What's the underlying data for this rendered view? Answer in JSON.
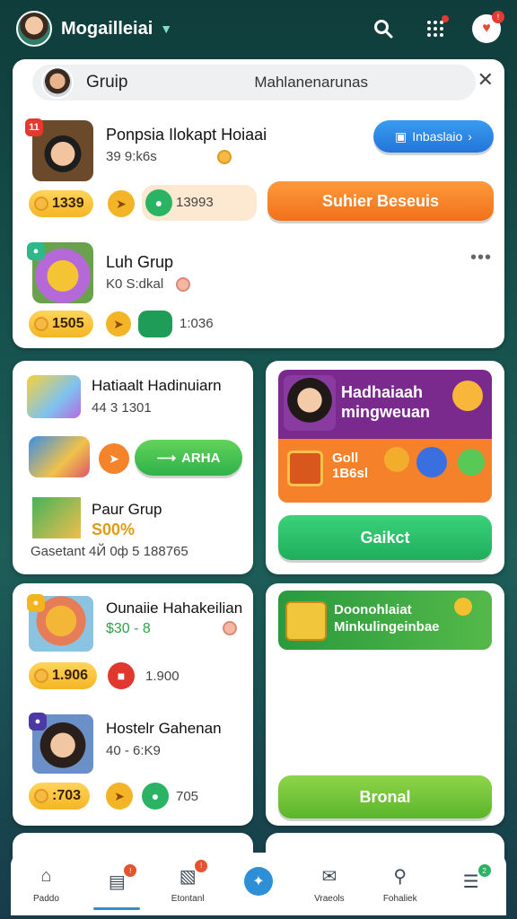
{
  "header": {
    "title": "Mogailleiai",
    "avatar_icon": "user-avatar",
    "actions": [
      "search-icon",
      "grid-icon",
      "notification-icon"
    ],
    "notification_badge": "!"
  },
  "search": {
    "left_text": "Gruip",
    "right_text": "Mahlanenarunas"
  },
  "groups": [
    {
      "badge": "11",
      "name": "Ponpsia Ilokapt Hoiaai",
      "sub": "39 9:k6s",
      "coins": "1339",
      "chip_value": "13993",
      "action_pill": "Inbaslaio",
      "main_button": "Suhier Beseuis"
    },
    {
      "badge": "",
      "name": "Luh Grup",
      "sub": "K0 S:dkal",
      "coins": "1505",
      "chip_value": "1:036"
    }
  ],
  "left_card_1": {
    "title": "Hatiaalt Hadinuiarn",
    "sub": "44 3 1301",
    "action_label": "ARHA",
    "second_title": "Paur Grup",
    "second_value": "S00%",
    "footer": "Gasetant 4Й 0ф 5 188765"
  },
  "right_card_1": {
    "banner_title": "Hadhaiaah mingweuan",
    "banner_sub": "Goll 1B6sl",
    "button": "Gaikct"
  },
  "left_card_2": {
    "items": [
      {
        "name": "Ounaiie Hahakeilian",
        "sub": "$30 - 8",
        "coins": "1.906",
        "extra": "1.900"
      },
      {
        "name": "Hostelr Gahenan",
        "sub": "40 - 6:K9",
        "coins": ":703",
        "extra": "705"
      }
    ]
  },
  "right_card_2": {
    "banner_title": "Doonohlaiat Minkulingeinbae",
    "button": "Bronal"
  },
  "nav": {
    "items": [
      {
        "icon": "home-icon",
        "label": "Paddo"
      },
      {
        "icon": "calendar-icon",
        "label": ""
      },
      {
        "icon": "shop-icon",
        "label": "Etontanl"
      },
      {
        "icon": "bird-icon",
        "label": ""
      },
      {
        "icon": "chat-icon",
        "label": "Vraeols"
      },
      {
        "icon": "search-icon",
        "label": "Fohaliek"
      },
      {
        "icon": "list-icon",
        "label": ""
      }
    ]
  },
  "colors": {
    "accent_orange": "#f5832a",
    "accent_green": "#34c26a",
    "accent_blue": "#2f8fd6"
  }
}
